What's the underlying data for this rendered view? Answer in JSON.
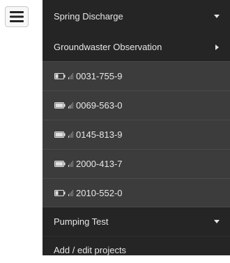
{
  "menu": {
    "toggle_icon": "hamburger-icon",
    "items": [
      {
        "label": "Spring Discharge",
        "caret": "caret-down-icon"
      },
      {
        "label": "Groundwaster Observation",
        "caret": "caret-right-icon"
      },
      {
        "label": "Pumping Test",
        "caret": "caret-down-icon"
      },
      {
        "label": "Add / edit projects"
      }
    ],
    "stations": [
      {
        "id": "0031-755-9",
        "battery": 0.4,
        "signal": 0.25
      },
      {
        "id": "0069-563-0",
        "battery": 1.0,
        "signal": 0.5
      },
      {
        "id": "0145-813-9",
        "battery": 1.0,
        "signal": 0.25
      },
      {
        "id": "2000-413-7",
        "battery": 1.0,
        "signal": 0.25
      },
      {
        "id": "2010-552-0",
        "battery": 0.4,
        "signal": 0.25
      }
    ]
  },
  "colors": {
    "menu_bg": "#252525",
    "submenu_bg": "#3c3c3c",
    "text": "#e6e6e6"
  }
}
